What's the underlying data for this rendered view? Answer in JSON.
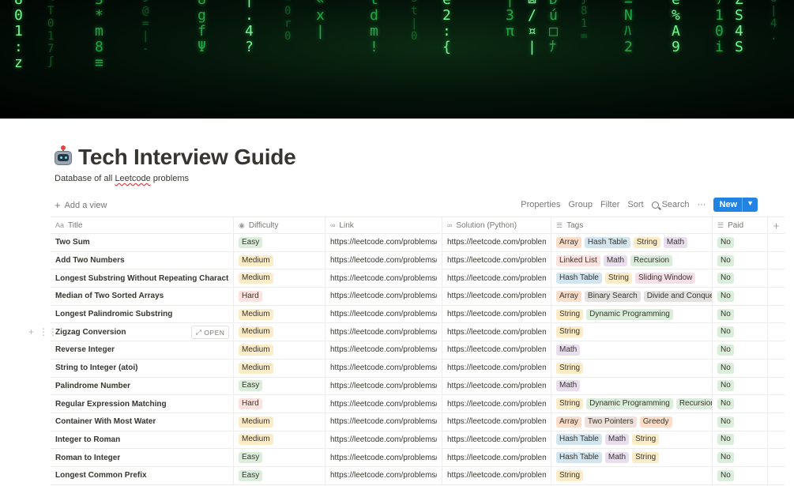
{
  "page": {
    "title": "Tech Interview Guide",
    "description_before": "Database of all ",
    "description_word": "Leetcode",
    "description_after": " problems",
    "icon": "robot-icon"
  },
  "toolbar": {
    "add_view": "Add a view",
    "properties": "Properties",
    "group": "Group",
    "filter": "Filter",
    "sort": "Sort",
    "search": "Search",
    "more": "···",
    "new": "New"
  },
  "columns": {
    "title": "Title",
    "difficulty": "Difficulty",
    "link": "Link",
    "solution": "Solution (Python)",
    "tags": "Tags",
    "paid": "Paid"
  },
  "open_label": "OPEN",
  "colors": {
    "easy": "#dbeddb",
    "medium": "#fdecc8",
    "hard": "#ffe2dd",
    "orange": "#fadec9",
    "blue": "#d3e5ef",
    "yellow": "#fdecc8",
    "purple": "#e8deee",
    "red": "#ffe2dd",
    "green": "#dbeddb",
    "pink": "#f5e0e9",
    "gray": "#e3e2e0",
    "brown": "#eee0da",
    "accent": "#2383e2"
  },
  "rows": [
    {
      "title": "Two Sum",
      "difficulty": "Easy",
      "link": "https://leetcode.com/problems/two-sum",
      "solution": "https://leetcode.com/problems",
      "tags": [
        [
          "Array",
          "orange"
        ],
        [
          "Hash Table",
          "blue"
        ],
        [
          "String",
          "yellow"
        ],
        [
          "Math",
          "purple"
        ]
      ],
      "paid": "No"
    },
    {
      "title": "Add Two Numbers",
      "difficulty": "Medium",
      "link": "https://leetcode.com/problems/add-two-numbers",
      "solution": "https://leetcode.com/problems",
      "tags": [
        [
          "Linked List",
          "red"
        ],
        [
          "Math",
          "purple"
        ],
        [
          "Recursion",
          "green"
        ]
      ],
      "paid": "No"
    },
    {
      "title": "Longest Substring Without Repeating Characters",
      "difficulty": "Medium",
      "link": "https://leetcode.com/problems/longest",
      "solution": "https://leetcode.com/problems",
      "tags": [
        [
          "Hash Table",
          "blue"
        ],
        [
          "String",
          "yellow"
        ],
        [
          "Sliding Window",
          "pink"
        ]
      ],
      "paid": "No"
    },
    {
      "title": "Median of Two Sorted Arrays",
      "difficulty": "Hard",
      "link": "https://leetcode.com/problems/median",
      "solution": "https://leetcode.com/problems",
      "tags": [
        [
          "Array",
          "orange"
        ],
        [
          "Binary Search",
          "gray"
        ],
        [
          "Divide and Conquer",
          "gray"
        ]
      ],
      "paid": "No"
    },
    {
      "title": "Longest Palindromic Substring",
      "difficulty": "Medium",
      "link": "https://leetcode.com/problems/longest",
      "solution": "https://leetcode.com/problems",
      "tags": [
        [
          "String",
          "yellow"
        ],
        [
          "Dynamic Programming",
          "green"
        ]
      ],
      "paid": "No"
    },
    {
      "title": "Zigzag Conversion",
      "difficulty": "Medium",
      "link": "https://leetcode.com/problems/zigzag",
      "solution": "https://leetcode.com/problems",
      "tags": [
        [
          "String",
          "yellow"
        ]
      ],
      "paid": "No",
      "hover": true
    },
    {
      "title": "Reverse Integer",
      "difficulty": "Medium",
      "link": "https://leetcode.com/problems/reverse",
      "solution": "https://leetcode.com/problems",
      "tags": [
        [
          "Math",
          "purple"
        ]
      ],
      "paid": "No"
    },
    {
      "title": "String to Integer (atoi)",
      "difficulty": "Medium",
      "link": "https://leetcode.com/problems/string",
      "solution": "https://leetcode.com/problems",
      "tags": [
        [
          "String",
          "yellow"
        ]
      ],
      "paid": "No"
    },
    {
      "title": "Palindrome Number",
      "difficulty": "Easy",
      "link": "https://leetcode.com/problems/palindrome",
      "solution": "https://leetcode.com/problems",
      "tags": [
        [
          "Math",
          "purple"
        ]
      ],
      "paid": "No"
    },
    {
      "title": "Regular Expression Matching",
      "difficulty": "Hard",
      "link": "https://leetcode.com/problems/regular",
      "solution": "https://leetcode.com/problems",
      "tags": [
        [
          "String",
          "yellow"
        ],
        [
          "Dynamic Programming",
          "green"
        ],
        [
          "Recursion",
          "green"
        ]
      ],
      "paid": "No"
    },
    {
      "title": "Container With Most Water",
      "difficulty": "Medium",
      "link": "https://leetcode.com/problems/container",
      "solution": "https://leetcode.com/problems",
      "tags": [
        [
          "Array",
          "orange"
        ],
        [
          "Two Pointers",
          "brown"
        ],
        [
          "Greedy",
          "orange"
        ]
      ],
      "paid": "No"
    },
    {
      "title": "Integer to Roman",
      "difficulty": "Medium",
      "link": "https://leetcode.com/problems/integer",
      "solution": "https://leetcode.com/problems",
      "tags": [
        [
          "Hash Table",
          "blue"
        ],
        [
          "Math",
          "purple"
        ],
        [
          "String",
          "yellow"
        ]
      ],
      "paid": "No"
    },
    {
      "title": "Roman to Integer",
      "difficulty": "Easy",
      "link": "https://leetcode.com/problems/roman",
      "solution": "https://leetcode.com/problems",
      "tags": [
        [
          "Hash Table",
          "blue"
        ],
        [
          "Math",
          "purple"
        ],
        [
          "String",
          "yellow"
        ]
      ],
      "paid": "No"
    },
    {
      "title": "Longest Common Prefix",
      "difficulty": "Easy",
      "link": "https://leetcode.com/problems/longest",
      "solution": "https://leetcode.com/problems",
      "tags": [
        [
          "String",
          "yellow"
        ]
      ],
      "paid": "No"
    }
  ]
}
